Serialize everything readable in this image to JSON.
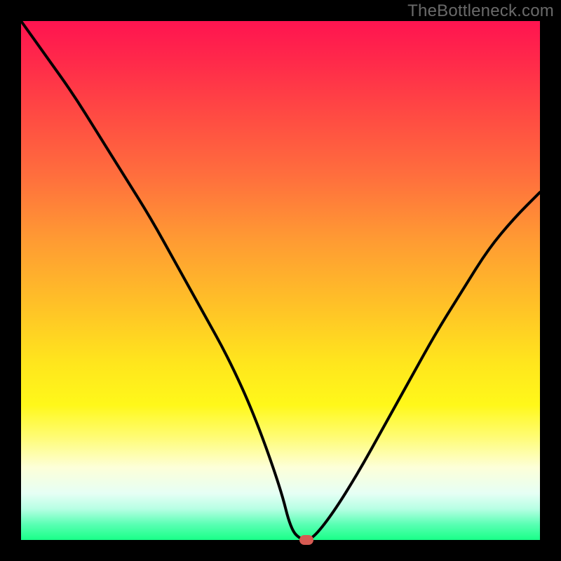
{
  "watermark": "TheBottleneck.com",
  "colors": {
    "frame": "#000000",
    "curve": "#000000",
    "marker": "#d65a52",
    "watermark": "#6a6a6a"
  },
  "chart_data": {
    "type": "line",
    "title": "",
    "xlabel": "",
    "ylabel": "",
    "xlim": [
      0,
      100
    ],
    "ylim": [
      0,
      100
    ],
    "grid": false,
    "series": [
      {
        "name": "bottleneck-curve",
        "x": [
          0,
          5,
          10,
          15,
          20,
          25,
          30,
          35,
          40,
          45,
          50,
          52,
          54,
          56,
          60,
          65,
          70,
          75,
          80,
          85,
          90,
          95,
          100
        ],
        "y": [
          100,
          93,
          86,
          78,
          70,
          62,
          53,
          44,
          35,
          24,
          10,
          2,
          0,
          0,
          5,
          13,
          22,
          31,
          40,
          48,
          56,
          62,
          67
        ]
      }
    ],
    "flat_bottom": {
      "x_start": 52,
      "x_end": 56,
      "y": 0
    },
    "marker": {
      "x": 55,
      "y": 0
    },
    "gradient_stops": [
      {
        "pct": 0,
        "color": "#ff1450"
      },
      {
        "pct": 18,
        "color": "#ff4a43"
      },
      {
        "pct": 42,
        "color": "#ff9a33"
      },
      {
        "pct": 66,
        "color": "#ffe61d"
      },
      {
        "pct": 86,
        "color": "#fdffd8"
      },
      {
        "pct": 100,
        "color": "#19ff88"
      }
    ]
  }
}
